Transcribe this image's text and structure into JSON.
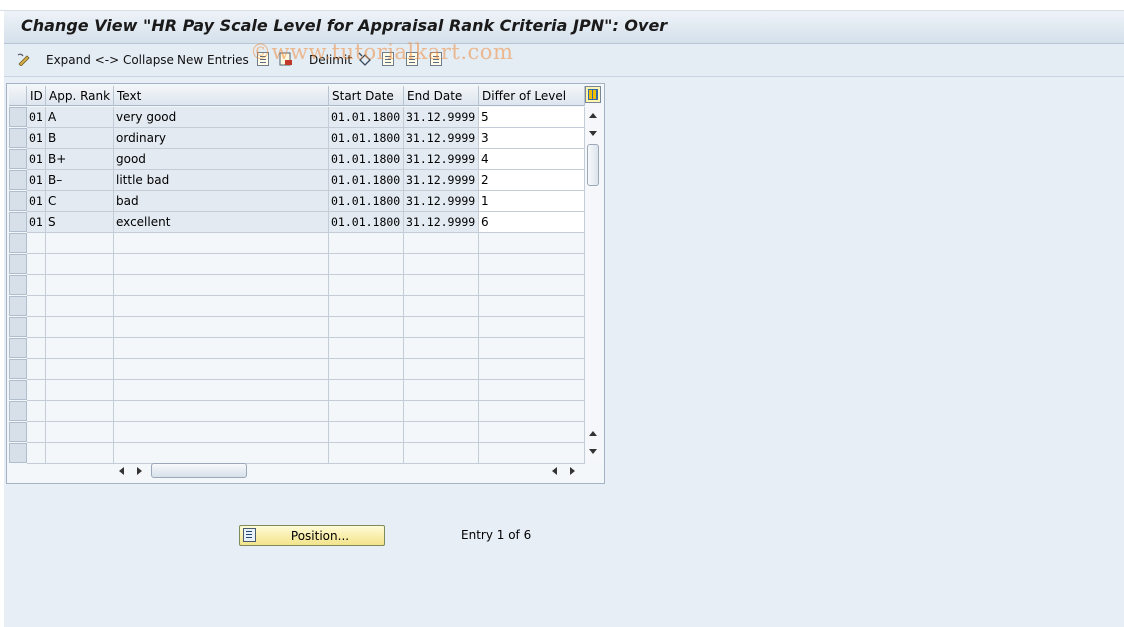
{
  "window": {
    "title": "Change View \"HR Pay Scale Level for Appraisal Rank Criteria JPN\": Over"
  },
  "toolbar": {
    "expand_collapse_label": "Expand <-> Collapse",
    "new_entries_label": "New Entries",
    "delimit_label": "Delimit"
  },
  "watermark": "©www.tutorialkart.com",
  "table": {
    "columns": [
      "ID",
      "App. Rank",
      "Text",
      "Start Date",
      "End Date",
      "Differ of Level"
    ],
    "rows": [
      [
        "01",
        "A",
        "very good",
        "01.01.1800",
        "31.12.9999",
        "5"
      ],
      [
        "01",
        "B",
        "ordinary",
        "01.01.1800",
        "31.12.9999",
        "3"
      ],
      [
        "01",
        "B+",
        "good",
        "01.01.1800",
        "31.12.9999",
        "4"
      ],
      [
        "01",
        "B–",
        "little bad",
        "01.01.1800",
        "31.12.9999",
        "2"
      ],
      [
        "01",
        "C",
        "bad",
        "01.01.1800",
        "31.12.9999",
        "1"
      ],
      [
        "01",
        "S",
        "excellent",
        "01.01.1800",
        "31.12.9999",
        "6"
      ]
    ]
  },
  "footer": {
    "position_button_label": "Position...",
    "entry_counter": "Entry 1 of 6"
  },
  "colors": {
    "title_gradient_top": "#eef3f8",
    "background": "#e8eef5",
    "readonly_cell": "#e3eaf2",
    "editable_cell": "#ffffff",
    "position_button": "#f3e38a"
  }
}
